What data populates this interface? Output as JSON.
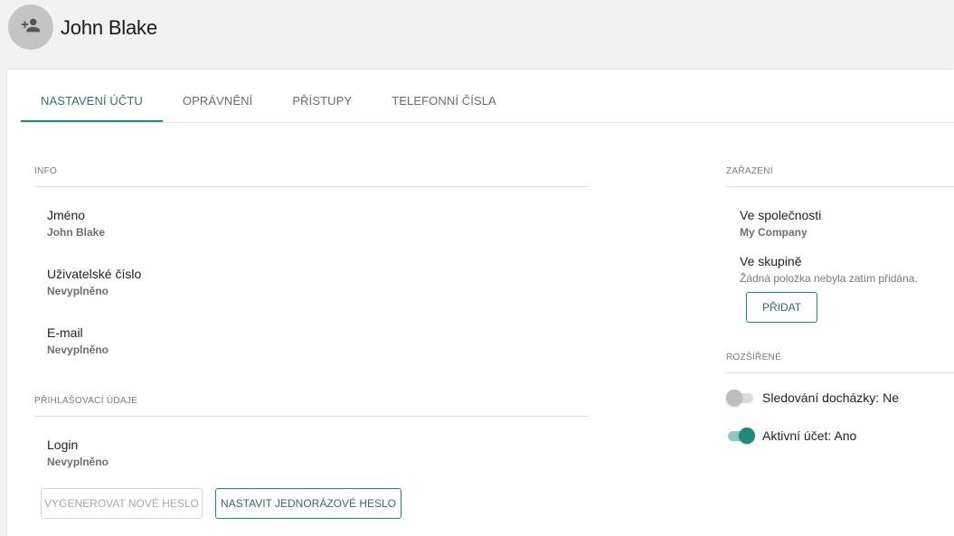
{
  "user": {
    "name": "John Blake",
    "avatar_icon": "person-add-icon"
  },
  "tabs": [
    {
      "label": "NASTAVENÍ ÚČTU",
      "active": true
    },
    {
      "label": "OPRÁVNĚNÍ",
      "active": false
    },
    {
      "label": "PŘÍSTUPY",
      "active": false
    },
    {
      "label": "TELEFONNÍ ČÍSLA",
      "active": false
    }
  ],
  "info": {
    "title": "INFO",
    "fields": [
      {
        "label": "Jméno",
        "value": "John Blake"
      },
      {
        "label": "Uživatelské číslo",
        "value": "Nevyplněno"
      },
      {
        "label": "E-mail",
        "value": "Nevyplněno"
      }
    ]
  },
  "login_section": {
    "title": "PŘIHLAŠOVACÍ ÚDAJE",
    "field": {
      "label": "Login",
      "value": "Nevyplněno"
    },
    "generate_button": "VYGENEROVAT NOVÉ HESLO",
    "one_time_button": "NASTAVIT JEDNORÁZOVÉ HESLO"
  },
  "assignment": {
    "title": "ZAŘAZENÍ",
    "company_label": "Ve společnosti",
    "company_value": "My Company",
    "group_label": "Ve skupině",
    "group_value": "Žádná položka nebyla zatím přidána.",
    "add_button": "PŘIDAT"
  },
  "extended": {
    "title": "ROZŠÍŘENÉ",
    "attendance": {
      "label": "Sledování docházky: Ne",
      "on": false
    },
    "active": {
      "label": "Aktivní účet: Ano",
      "on": true
    }
  },
  "colors": {
    "accent": "#1d8a7d",
    "background": "#f2f2f2",
    "card": "#ffffff"
  }
}
